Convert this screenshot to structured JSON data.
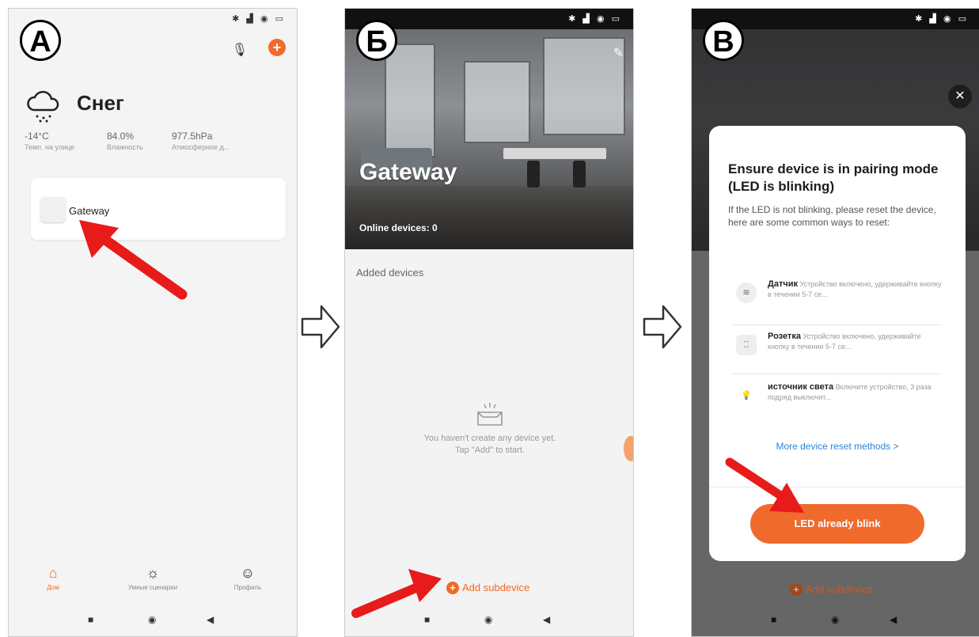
{
  "labels": {
    "a": "A",
    "b": "Б",
    "c": "В"
  },
  "status_icons": "✱ ▟ ◉ ▭",
  "phone_a": {
    "weather": {
      "condition": "Снег"
    },
    "stats": [
      {
        "value": "-14°C",
        "label": "Темп. на улице"
      },
      {
        "value": "84.0%",
        "label": "Влажность"
      },
      {
        "value": "977.5hPa",
        "label": "Атмосферное д..."
      }
    ],
    "device": {
      "name": "Gateway"
    },
    "nav": [
      {
        "label": "Дом",
        "icon": "home-icon"
      },
      {
        "label": "Умные сценарии",
        "icon": "sun-icon"
      },
      {
        "label": "Профиль",
        "icon": "profile-icon"
      }
    ]
  },
  "phone_b": {
    "title": "Gateway",
    "online": "Online devices: 0",
    "section": "Added devices",
    "empty_line1": "You haven't create any device yet.",
    "empty_line2": "Tap \"Add\" to start.",
    "add_label": "Add subdevice"
  },
  "phone_c": {
    "modal_title": "Ensure device is in pairing mode (LED is blinking)",
    "modal_desc": "If the LED is not blinking, please reset the device, here are some common ways to reset:",
    "methods": [
      {
        "name": "Датчик",
        "desc": "Устройство включено, удерживайте кнопку в течении 5-7 се..."
      },
      {
        "name": "Розетка",
        "desc": "Устройство включено, удерживайте кнопку в течении 5-7 се..."
      },
      {
        "name": "источник света",
        "desc": "Включите устройство, 3 раза подряд выключит..."
      }
    ],
    "more_link": "More device reset methods >",
    "confirm_button": "LED already blink",
    "add_label": "Add subdevice"
  },
  "colors": {
    "accent": "#f06a2b",
    "link": "#2a86d8",
    "annotation": "#e81b1b"
  }
}
